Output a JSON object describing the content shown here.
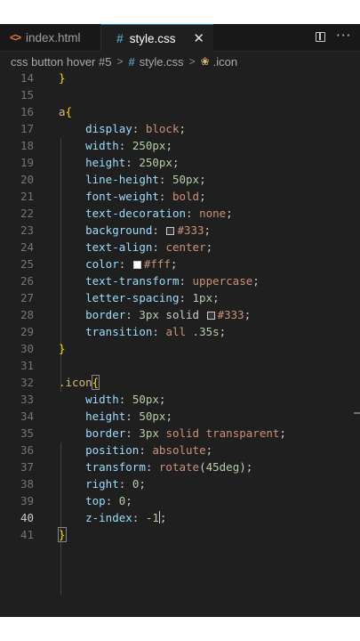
{
  "tabs": [
    {
      "label": "index.html",
      "icon": "html-icon",
      "active": false
    },
    {
      "label": "style.css",
      "icon": "css-hash-icon",
      "active": true
    }
  ],
  "breadcrumb": [
    "css button hover #5",
    "style.css",
    ".icon"
  ],
  "editor": {
    "active_line": 40,
    "lines": [
      {
        "n": "14",
        "text": "}"
      },
      {
        "n": "15",
        "text": ""
      },
      {
        "n": "16",
        "text": "a{"
      },
      {
        "n": "17",
        "text": "display: block;"
      },
      {
        "n": "18",
        "text": "width: 250px;"
      },
      {
        "n": "19",
        "text": "height: 250px;"
      },
      {
        "n": "20",
        "text": "line-height: 50px;"
      },
      {
        "n": "21",
        "text": "font-weight: bold;"
      },
      {
        "n": "22",
        "text": "text-decoration: none;"
      },
      {
        "n": "23",
        "text": "background: #333;"
      },
      {
        "n": "24",
        "text": "text-align: center;"
      },
      {
        "n": "25",
        "text": "color: #fff;"
      },
      {
        "n": "26",
        "text": "text-transform: uppercase;"
      },
      {
        "n": "27",
        "text": "letter-spacing: 1px;"
      },
      {
        "n": "28",
        "text": "border: 3px solid #333;"
      },
      {
        "n": "29",
        "text": "transition: all .35s;"
      },
      {
        "n": "30",
        "text": "}"
      },
      {
        "n": "31",
        "text": ""
      },
      {
        "n": "32",
        "text": ".icon{"
      },
      {
        "n": "33",
        "text": "width: 50px;"
      },
      {
        "n": "34",
        "text": "height: 50px;"
      },
      {
        "n": "35",
        "text": "border: 3px solid transparent;"
      },
      {
        "n": "36",
        "text": "position: absolute;"
      },
      {
        "n": "37",
        "text": "transform: rotate(45deg);"
      },
      {
        "n": "38",
        "text": "right: 0;"
      },
      {
        "n": "39",
        "text": "top: 0;"
      },
      {
        "n": "40",
        "text": "z-index: -1;"
      },
      {
        "n": "41",
        "text": "}"
      }
    ]
  },
  "colors": {
    "editor_bg": "#1f1f1f",
    "property": "#9cdcfe",
    "value": "#ce9178",
    "number": "#b5cea8",
    "selector": "#d7ba7d",
    "brace": "#ffd700",
    "swatch_333": "#333333",
    "swatch_fff": "#ffffff"
  }
}
